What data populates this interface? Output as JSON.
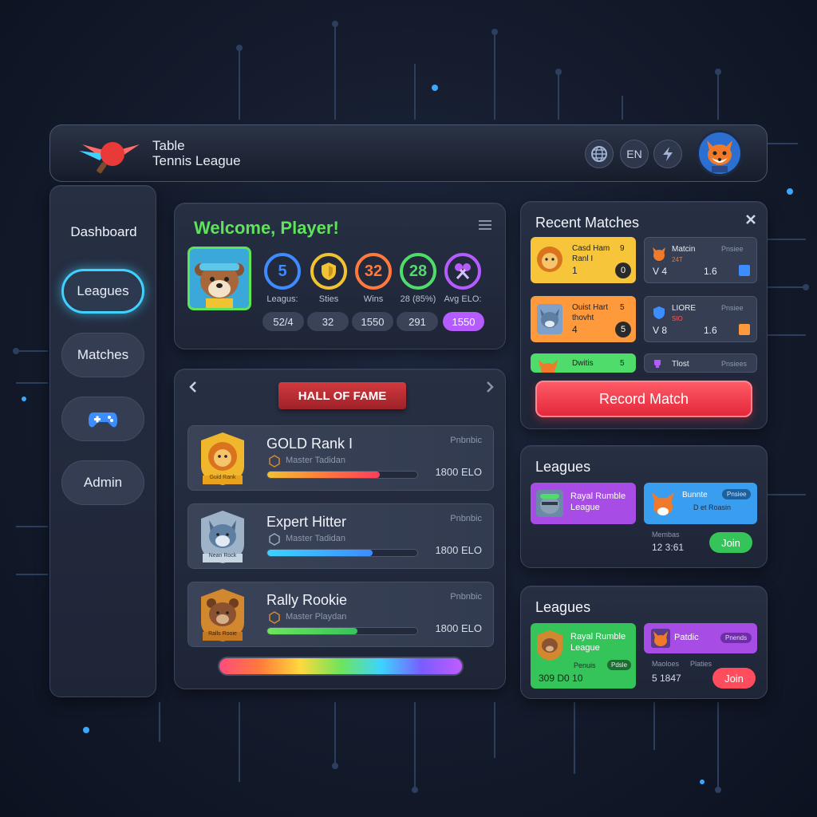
{
  "header": {
    "title_line1": "Table",
    "title_line2": "Tennis League",
    "lang_label": "EN"
  },
  "sidebar": {
    "items": [
      {
        "label": "Dashboard"
      },
      {
        "label": "Leagues"
      },
      {
        "label": "Matches"
      },
      {
        "label": ""
      },
      {
        "label": "Admin"
      }
    ]
  },
  "welcome": {
    "title": "Welcome, Player!",
    "stats": [
      {
        "value": "5",
        "label": "Leagus:",
        "pill": "52/4",
        "color": "#3d8bff"
      },
      {
        "value": "",
        "label": "Sties",
        "pill": "32",
        "color": "#f1c232"
      },
      {
        "value": "32",
        "label": "Wins",
        "pill": "1550",
        "color": "#ff7a3c"
      },
      {
        "value": "28",
        "label": "28 (85%)",
        "pill": "291",
        "color": "#4fdc6a"
      },
      {
        "value": "",
        "label": "Avg ELO:",
        "pill": "1550",
        "color": "#b45cff"
      }
    ]
  },
  "hall_of_fame": {
    "title": "HALL OF FAME",
    "rows": [
      {
        "name": "GOLD Rank I",
        "subtitle": "Master Tadidan",
        "tag": "Pnbnbic",
        "elo": "1800 ELO",
        "badge_text": "Guid Rank",
        "progress": 0.75
      },
      {
        "name": "Expert Hitter",
        "subtitle": "Master Tadidan",
        "tag": "Pnbnbic",
        "elo": "1800 ELO",
        "badge_text": "Nean Rock",
        "progress": 0.7
      },
      {
        "name": "Rally Rookie",
        "subtitle": "Master Playdan",
        "tag": "Pnbnbic",
        "elo": "1800 ELO",
        "badge_text": "Ralls Rooie",
        "progress": 0.6
      }
    ]
  },
  "recent_matches": {
    "title": "Recent Matches",
    "cards": [
      {
        "l1": "Casd Ham",
        "l2": "Ranl I",
        "l3": "1",
        "n1": "9",
        "n2": "0"
      },
      {
        "l1": "Matcin",
        "l2": "24T",
        "l3": "V   4",
        "n1": "Pnsiee",
        "n2": "1.6"
      },
      {
        "l1": "Ouist Hart",
        "l2": "thovht",
        "l3": "4",
        "n1": "5",
        "n2": "5"
      },
      {
        "l1": "LIORE",
        "l2": "SIO",
        "l3": "V   8",
        "n1": "Pnsiee",
        "n2": "1.6"
      },
      {
        "l1": "Dwitis",
        "n1": "5"
      },
      {
        "l1": "Tlost",
        "n1": "Pnsiees"
      }
    ],
    "record_button": "Record Match"
  },
  "leagues_1": {
    "title": "Leagues",
    "card1": "Rayal Rumble League",
    "card2_l1": "Bunnte",
    "card2_l2": "D et Roasin",
    "card2_badge": "Pnsiee",
    "members_label": "Membas",
    "members": "12   3:61",
    "join": "Join"
  },
  "leagues_2": {
    "title": "Leagues",
    "card1": "Rayal Rumble League",
    "card1_sub": "Penuis",
    "card1_badge": "Pdsle",
    "card1_nums": "309 D0   10",
    "card2": "Patdic",
    "card2_badge": "Pnends",
    "members_label": "Maoloes",
    "players_label": "Platies",
    "members": "5   1847",
    "join": "Join"
  },
  "colors": {
    "accent_cyan": "#3fd2ff",
    "welcome_green": "#5ee35b",
    "record_red": "#e3283a",
    "join_green": "#35c45a"
  }
}
